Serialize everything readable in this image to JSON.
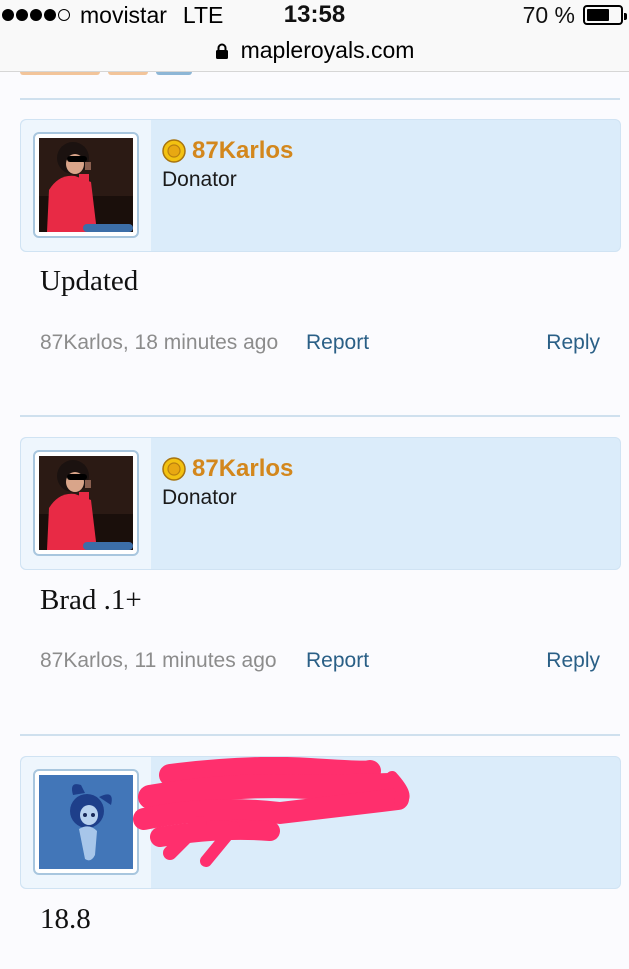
{
  "status_bar": {
    "carrier": "movistar",
    "network": "LTE",
    "time": "13:58",
    "battery": "70 %",
    "battery_level": 0.7
  },
  "url_bar": {
    "url": "mapleroyals.com",
    "icon": "lock-icon"
  },
  "colors": {
    "username": "#d3871c",
    "link": "#2a5f86",
    "header_bg": "#dbecfa",
    "redaction": "#ff2f6d"
  },
  "posts": [
    {
      "username": "87Karlos",
      "user_title": "Donator",
      "badge_icon": "gold-coin-icon",
      "message": "Updated",
      "meta": "87Karlos, 18 minutes ago",
      "report": "Report",
      "reply": "Reply"
    },
    {
      "username": "87Karlos",
      "user_title": "Donator",
      "badge_icon": "gold-coin-icon",
      "message": "Brad .1+",
      "meta": "87Karlos, 11 minutes ago",
      "report": "Report",
      "reply": "Reply"
    },
    {
      "message": "18.8"
    }
  ]
}
